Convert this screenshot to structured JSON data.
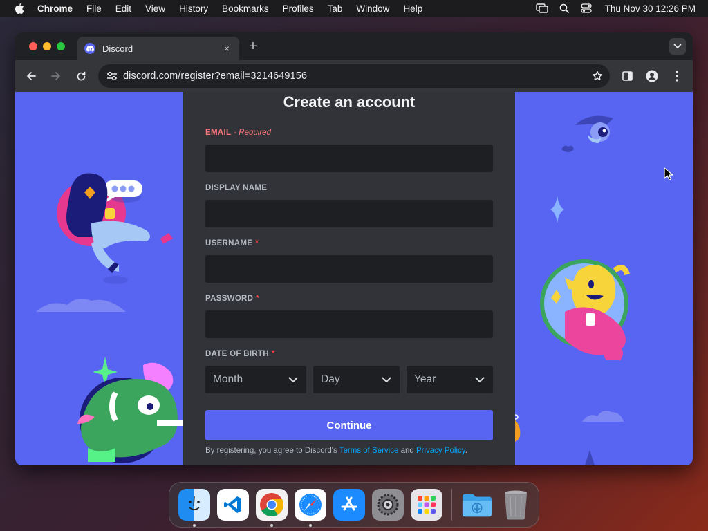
{
  "menubar": {
    "app_name": "Chrome",
    "items": [
      "File",
      "Edit",
      "View",
      "History",
      "Bookmarks",
      "Profiles",
      "Tab",
      "Window",
      "Help"
    ],
    "clock": "Thu Nov 30  12:26 PM"
  },
  "browser": {
    "tab_title": "Discord",
    "tab_close": "×",
    "new_tab": "+",
    "url": "discord.com/register?email=3214649156"
  },
  "form": {
    "title": "Create an account",
    "email": {
      "label": "EMAIL",
      "hint": "- Required",
      "value": ""
    },
    "display_name": {
      "label": "DISPLAY NAME",
      "value": ""
    },
    "username": {
      "label": "USERNAME",
      "required_mark": "*",
      "value": ""
    },
    "password": {
      "label": "PASSWORD",
      "required_mark": "*",
      "value": ""
    },
    "dob": {
      "label": "DATE OF BIRTH",
      "required_mark": "*",
      "month_placeholder": "Month",
      "day_placeholder": "Day",
      "year_placeholder": "Year"
    },
    "continue_label": "Continue",
    "legal": {
      "prefix": "By registering, you agree to Discord's ",
      "terms": "Terms of Service",
      "and": " and ",
      "privacy": "Privacy Policy",
      "suffix": "."
    }
  },
  "colors": {
    "discord_blurple": "#5865f2",
    "panel_bg": "#313338",
    "input_bg": "#1e1f22",
    "error_red": "#fa777c",
    "link_blue": "#00a8fc"
  },
  "dock": {
    "apps": [
      "finder-icon",
      "vscode-icon",
      "chrome-icon",
      "safari-icon",
      "app-store-icon",
      "system-settings-icon",
      "launchpad-icon",
      "downloads-folder-icon",
      "trash-icon"
    ]
  }
}
